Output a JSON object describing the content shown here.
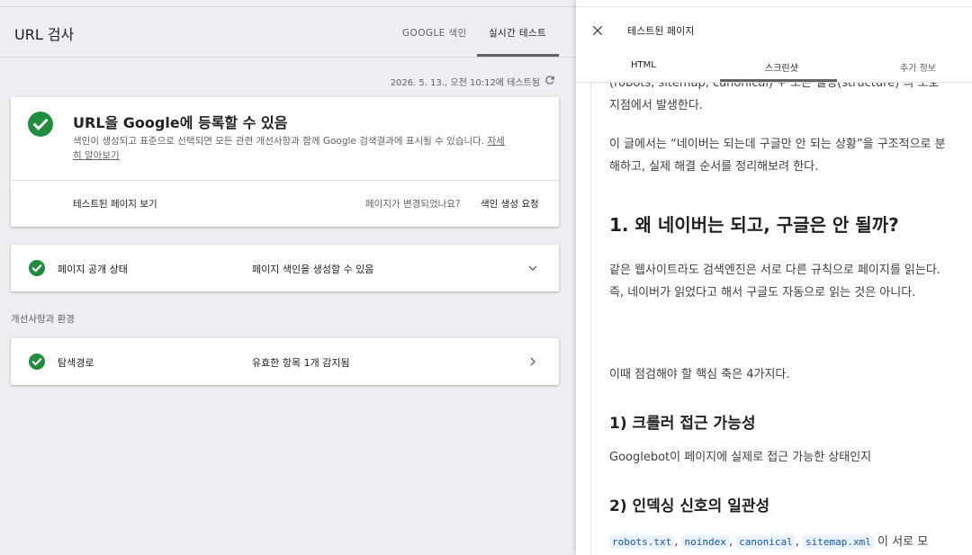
{
  "header": {
    "title": "URL 검사",
    "tabs": [
      {
        "label": "GOOGLE 색인"
      },
      {
        "label": "실시간 테스트"
      }
    ]
  },
  "timestamp": "2026. 5. 13., 오전 10:12에 테스트됨",
  "main_card": {
    "title": "URL을 Google에 등록할 수 있음",
    "description": "색인이 생성되고 표준으로 선택되면 모든 관련 개선사항과 함께 Google 검색결과에 표시될 수 있습니다.",
    "learn_more": "자세히 알아보기",
    "view_tested": "테스트된 페이지 보기",
    "changed_question": "페이지가 변경되었나요?",
    "request_indexing": "색인 생성 요청"
  },
  "availability": {
    "label": "페이지 공개 상태",
    "value": "페이지 색인을 생성할 수 있음"
  },
  "section_label": "개선사항과 환경",
  "crawl": {
    "label": "탐색경로",
    "value": "유효한 항목 1개 감지됨"
  },
  "panel": {
    "title": "테스트된 페이지",
    "tabs": [
      {
        "label": "HTML"
      },
      {
        "label": "스크린샷"
      },
      {
        "label": "추가 정보"
      }
    ]
  },
  "screenshot": {
    "cut_line1": "(robots, sitemap, canonical) + 오픈 설정(structure) 의 모호",
    "cut_line2": "지점에서 발생한다.",
    "p1": "이 글에서는 “네이버는 되는데 구글만 안 되는 상황”을 구조적으로 분해하고, 실제 해결 순서를 정리해보려 한다.",
    "h2": "1. 왜 네이버는 되고, 구글은 안 될까?",
    "p2a": "같은 웹사이트라도 검색엔진은 서로 다른 규칙으로 페이지를 읽는다.",
    "p2b": "즉, 네이버가 읽었다고 해서 구글도 자동으로 읽는 것은 아니다.",
    "p3": "이때 점검해야 할 핵심 축은 4가지다.",
    "h3a": "1) 크롤러 접근 가능성",
    "p4": "Googlebot이 페이지에 실제로 접근 가능한 상태인지",
    "h3b": "2) 인덱싱 신호의 일관성",
    "codes": [
      "robots.txt",
      "noindex",
      "canonical",
      "sitemap.xml"
    ],
    "code_sep": ",",
    "code_tail": "이 서로 모"
  },
  "colors": {
    "success_green": "#1e8e3e",
    "accent": "#5f6368"
  }
}
